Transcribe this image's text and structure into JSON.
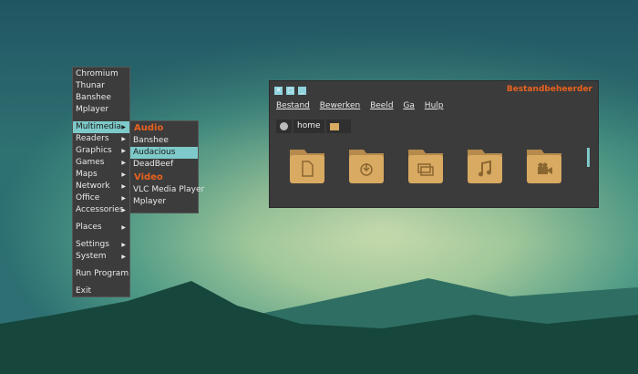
{
  "menu": {
    "items": [
      "Chromium",
      "Thunar",
      "Banshee",
      "Mplayer"
    ],
    "categories": [
      "Multimedia",
      "Readers",
      "Graphics",
      "Games",
      "Maps",
      "Network",
      "Office",
      "Accessories"
    ],
    "places": "Places",
    "settings": "Settings",
    "system": "System",
    "run": "Run Program",
    "exit": "Exit"
  },
  "submenu": {
    "audio_header": "Audio",
    "audio": [
      "Banshee",
      "Audacious",
      "DeadBeef"
    ],
    "video_header": "Video",
    "video": [
      "VLC Media Player",
      "Mplayer"
    ]
  },
  "window": {
    "title": "Bestandbeheerder",
    "menubar": [
      "Bestand",
      "Bewerken",
      "Beeld",
      "Ga",
      "Hulp"
    ],
    "path": "home",
    "folders": [
      "documents-icon",
      "downloads-icon",
      "pictures-icon",
      "music-icon",
      "videos-icon"
    ]
  },
  "colors": {
    "accent": "#e8621f",
    "highlight": "#7ec9c9",
    "folder": "#d9aa62"
  }
}
